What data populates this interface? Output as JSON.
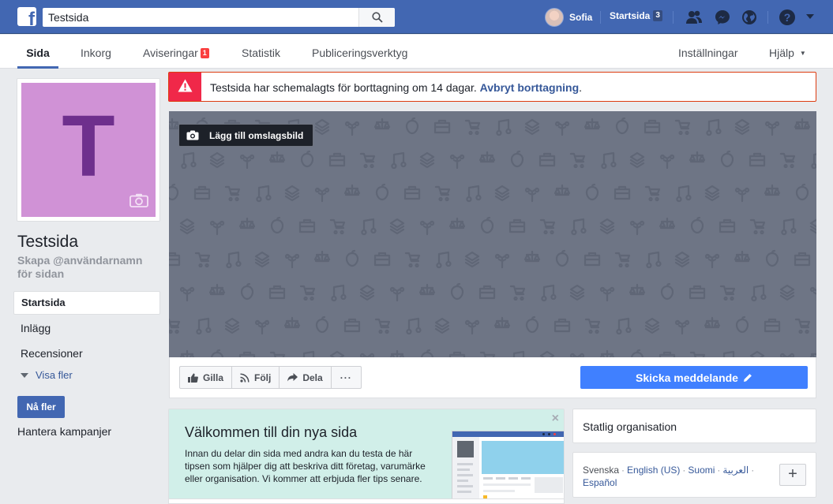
{
  "topbar": {
    "logo_letter": "f",
    "search_value": "Testsida",
    "user_name": "Sofia",
    "home_label": "Startsida",
    "home_count": "3",
    "brand_color": "#4267b2"
  },
  "pagenav": {
    "tabs": [
      {
        "label": "Sida",
        "active": true
      },
      {
        "label": "Inkorg"
      },
      {
        "label": "Aviseringar",
        "badge": "1"
      },
      {
        "label": "Statistik"
      },
      {
        "label": "Publiceringsverktyg"
      }
    ],
    "settings_label": "Inställningar",
    "help_label": "Hjälp"
  },
  "alert": {
    "text": "Testsida har schemalagts för borttagning om 14 dagar. ",
    "link": "Avbryt borttagning",
    "period": "."
  },
  "profile": {
    "letter": "T",
    "name": "Testsida",
    "username_prompt": "Skapa @användarnamn för sidan"
  },
  "leftnav": {
    "items": [
      "Startsida",
      "Inlägg",
      "Recensioner"
    ],
    "more_label": "Visa fler",
    "reach_button": "Nå fler",
    "campaigns_label": "Hantera kampanjer"
  },
  "cover": {
    "add_cover_label": "Lägg till omslagsbild"
  },
  "actions": {
    "like": "Gilla",
    "follow": "Följ",
    "share": "Dela",
    "more": "···",
    "send_message": "Skicka meddelande"
  },
  "welcome": {
    "title": "Välkommen till din nya sida",
    "text": "Innan du delar din sida med andra kan du testa de här tipsen som hjälper dig att beskriva ditt företag, varumärke eller organisation. Vi kommer att erbjuda fler tips senare.",
    "close": "×"
  },
  "sidebar": {
    "category": "Statlig organisation",
    "languages": {
      "current": "Svenska",
      "links": [
        "English (US)",
        "Suomi",
        "العربية",
        "Español"
      ],
      "add": "+"
    }
  }
}
